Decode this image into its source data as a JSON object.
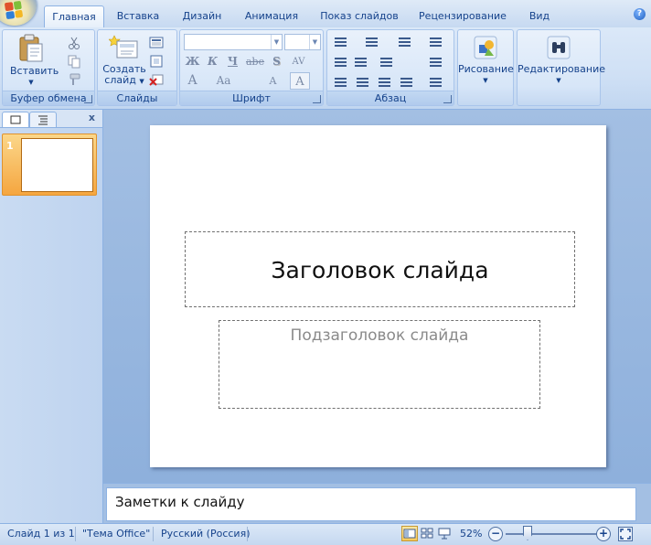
{
  "tabs": [
    "Главная",
    "Вставка",
    "Дизайн",
    "Анимация",
    "Показ слайдов",
    "Рецензирование",
    "Вид"
  ],
  "ribbon": {
    "clipboard": {
      "paste_label": "Вставить",
      "group_label": "Буфер обмена"
    },
    "slides": {
      "create_label_1": "Создать",
      "create_label_2": "слайд",
      "group_label": "Слайды"
    },
    "font": {
      "group_label": "Шрифт",
      "bold": "Ж",
      "italic": "К",
      "underline": "Ч",
      "strike": "abe",
      "shadow": "S",
      "spacing": "AV",
      "grow": "A",
      "case": "Aa",
      "shrink": "A",
      "color_a": "A"
    },
    "paragraph": {
      "group_label": "Абзац"
    },
    "drawing_label": "Рисование",
    "editing_label": "Редактирование"
  },
  "slide_panel": {
    "slide_number": "1",
    "close_glyph": "x"
  },
  "slide": {
    "title": "Заголовок слайда",
    "subtitle": "Подзаголовок слайда"
  },
  "notes": {
    "placeholder": "Заметки к слайду"
  },
  "status": {
    "slide_info": "Слайд 1 из 1",
    "theme": "\"Тема Office\"",
    "language": "Русский (Россия)",
    "zoom": "52%"
  },
  "zoom_level": 0.52,
  "colors": {
    "accent": "#15428b",
    "selected_thumb": "#f5a640"
  }
}
